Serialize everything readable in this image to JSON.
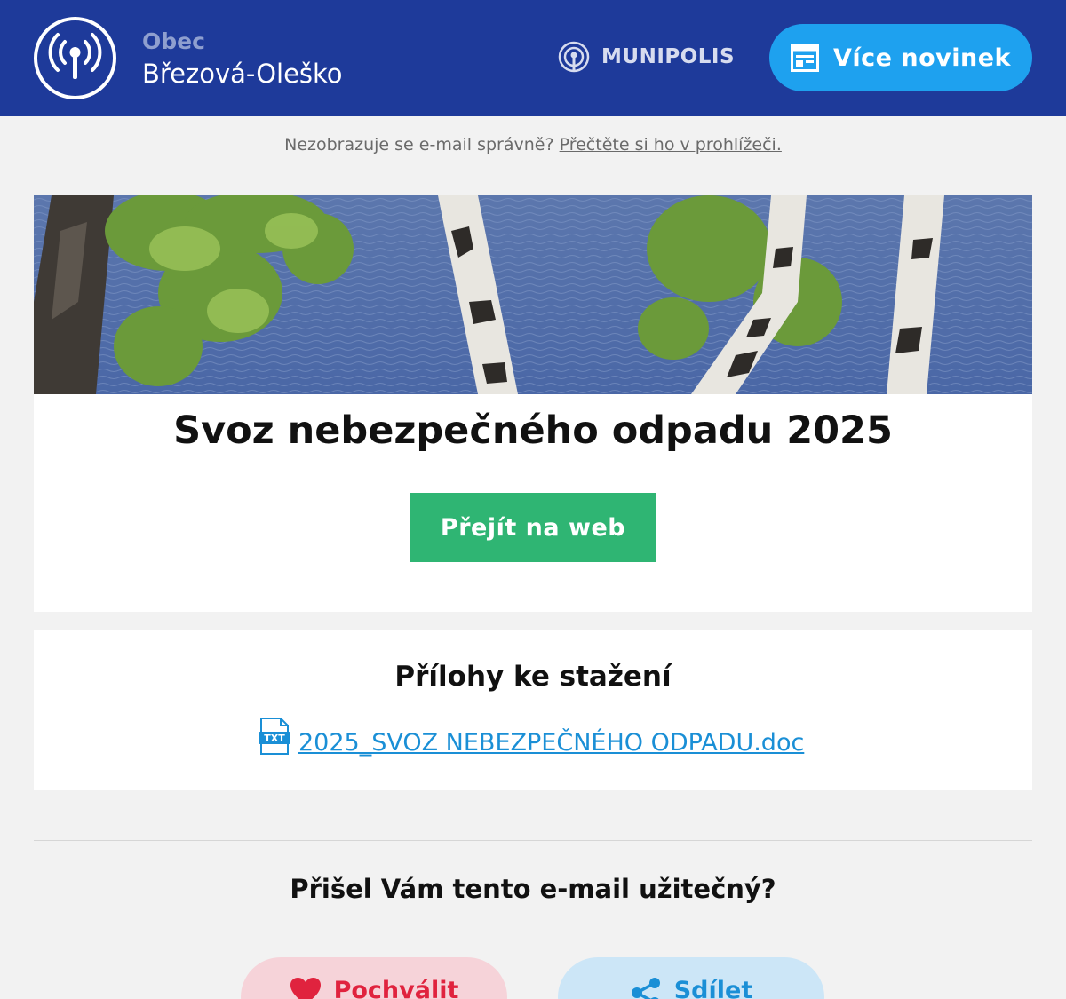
{
  "header": {
    "org_prefix": "Obec",
    "org_name": "Březová-Oleško",
    "brand": "MUNIPOLIS",
    "more_news_label": "Více novinek"
  },
  "notice": {
    "text": "Nezobrazuje se e-mail správně?",
    "link": "Přečtěte si ho v prohlížeči."
  },
  "article": {
    "title": "Svoz nebezpečného odpadu 2025",
    "button_label": "Přejít na web"
  },
  "attachments": {
    "title": "Přílohy ke stažení",
    "files": [
      {
        "name": "2025_SVOZ NEBEZPEČNÉHO ODPADU.doc",
        "icon": "txt-file-icon"
      }
    ]
  },
  "feedback": {
    "question": "Přišel Vám tento e-mail užitečný?",
    "praise_label": "Pochválit",
    "share_label": "Sdílet"
  },
  "colors": {
    "header_bg": "#1e3a9a",
    "accent_blue": "#1ea1ef",
    "green": "#2fb573",
    "link_blue": "#1a8fd6",
    "heart_red": "#e0233e"
  }
}
